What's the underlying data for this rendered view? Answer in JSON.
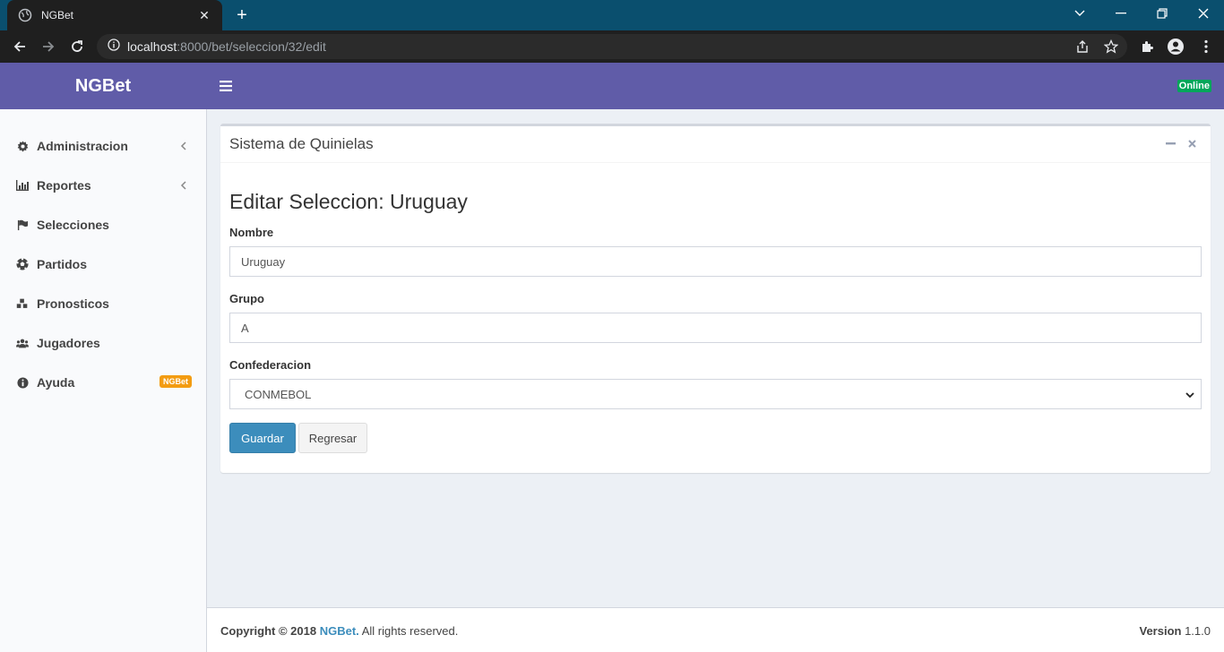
{
  "browser": {
    "tab_title": "NGBet",
    "url_host": "localhost",
    "url_path": ":8000/bet/seleccion/32/edit"
  },
  "header": {
    "logo": "NGBet",
    "status": "Online"
  },
  "sidebar": {
    "items": [
      {
        "label": "Administracion",
        "icon": "gear-icon"
      },
      {
        "label": "Reportes",
        "icon": "bar-chart-icon"
      },
      {
        "label": "Selecciones",
        "icon": "flag-icon"
      },
      {
        "label": "Partidos",
        "icon": "soccer-ball-icon"
      },
      {
        "label": "Pronosticos",
        "icon": "cubes-icon"
      },
      {
        "label": "Jugadores",
        "icon": "users-icon"
      },
      {
        "label": "Ayuda",
        "icon": "info-icon",
        "badge": "NGBet"
      }
    ]
  },
  "box": {
    "title": "Sistema de Quinielas"
  },
  "form": {
    "heading": "Editar Seleccion: Uruguay",
    "nombre_label": "Nombre",
    "nombre_value": "Uruguay",
    "grupo_label": "Grupo",
    "grupo_value": "A",
    "confederacion_label": "Confederacion",
    "confederacion_value": "CONMEBOL",
    "save_label": "Guardar",
    "back_label": "Regresar"
  },
  "footer": {
    "copyright_prefix": "Copyright © 2018",
    "brand": "NGBet.",
    "rights": "All rights reserved.",
    "version_label": "Version",
    "version_value": "1.1.0"
  },
  "colors": {
    "header": "#605ca8",
    "primary": "#3c8dbc",
    "online": "#00a65a",
    "badge": "#f39c12"
  }
}
